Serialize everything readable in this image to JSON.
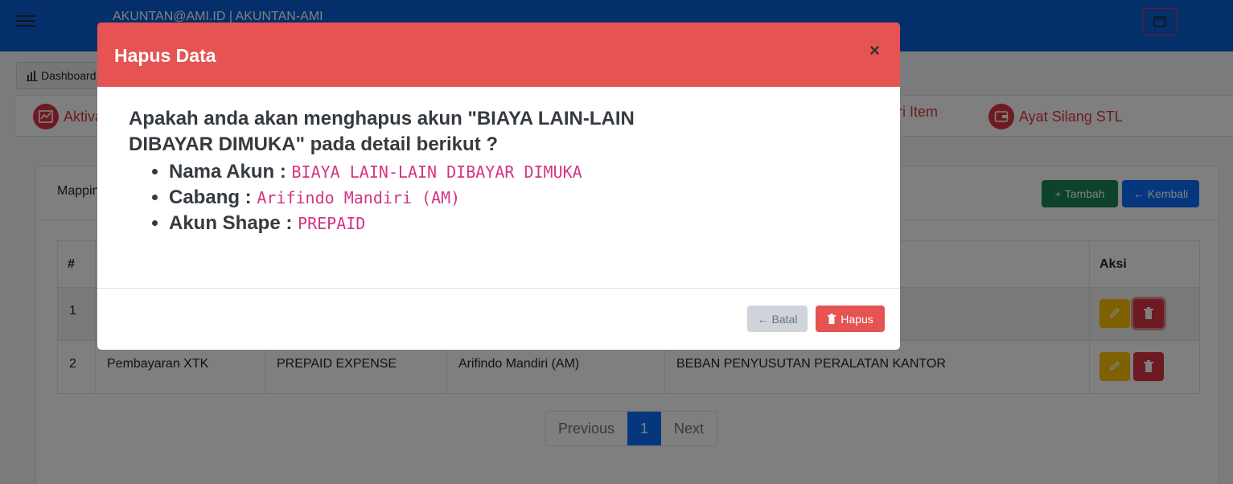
{
  "navbar": {
    "title": "AKUNTAN@AMI.ID | AKUNTAN-AMI"
  },
  "breadcrumb": {
    "label": "Dashboard"
  },
  "tabs": [
    {
      "label": "Aktiva",
      "icon": "chart-icon"
    },
    {
      "label": "Kategori Item",
      "icon": "tag-icon"
    },
    {
      "label": "Ayat Silang STL",
      "icon": "wallet-icon"
    }
  ],
  "card": {
    "title": "Mapping",
    "tambah_label": "Tambah",
    "kembali_label": "Kembali"
  },
  "table": {
    "headers": [
      "#",
      "",
      "",
      "",
      "",
      "Aksi"
    ],
    "rows": [
      {
        "no": "1",
        "nama": "",
        "akun_shape": "",
        "cabang": "",
        "akun": ""
      },
      {
        "no": "2",
        "nama": "Pembayaran XTK",
        "akun_shape": "PREPAID EXPENSE",
        "cabang": "Arifindo Mandiri (AM)",
        "akun": "BEBAN PENYUSUTAN PERALATAN KANTOR"
      }
    ]
  },
  "pagination": {
    "previous": "Previous",
    "current": "1",
    "next": "Next"
  },
  "modal": {
    "title": "Hapus Data",
    "close": "×",
    "question": "Apakah anda akan menghapus akun \"BIAYA LAIN-LAIN DIBAYAR DIMUKA\" pada detail berikut ?",
    "details": [
      {
        "label": "Nama Akun :",
        "value": "BIAYA LAIN-LAIN DIBAYAR DIMUKA"
      },
      {
        "label": "Cabang :",
        "value": "Arifindo Mandiri (AM)"
      },
      {
        "label": "Akun Shape :",
        "value": "PREPAID"
      }
    ],
    "batal_label": "Batal",
    "hapus_label": "Hapus"
  },
  "colors": {
    "primary": "#0d6efd",
    "danger": "#e55353",
    "success": "#198754",
    "warning": "#ffc107",
    "code": "#d63384"
  }
}
